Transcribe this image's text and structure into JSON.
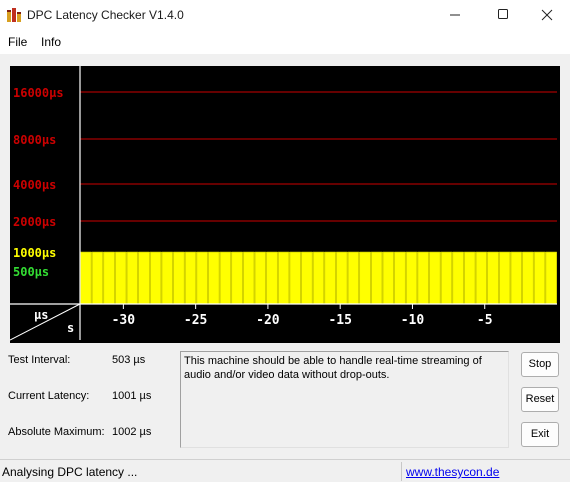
{
  "window": {
    "title": "DPC Latency Checker V1.4.0",
    "icon": "bar-chart-app-icon"
  },
  "menu": {
    "items": [
      "File",
      "Info"
    ]
  },
  "chart_data": {
    "type": "bar",
    "title": "",
    "xlabel": "s",
    "ylabel": "µs",
    "xlim": [
      -33,
      0
    ],
    "x_ticks": [
      -30,
      -25,
      -20,
      -15,
      -10,
      -5
    ],
    "y_scale": "log2",
    "y_ticks": [
      {
        "label": "16000µs",
        "value": 16000,
        "color": "#cc0000"
      },
      {
        "label": "8000µs",
        "value": 8000,
        "color": "#cc0000"
      },
      {
        "label": "4000µs",
        "value": 4000,
        "color": "#cc0000"
      },
      {
        "label": "2000µs",
        "value": 2000,
        "color": "#cc0000"
      },
      {
        "label": "1000µs",
        "value": 1000,
        "color": "#ffff00"
      },
      {
        "label": "500µs",
        "value": 500,
        "color": "#33dd33"
      }
    ],
    "bar_count": 41,
    "bar_value": 1000,
    "bar_color": "#ffff00",
    "background": "#000000",
    "grid": true
  },
  "stats": {
    "interval_label": "Test Interval:",
    "interval_value": "503 µs",
    "current_label": "Current Latency:",
    "current_value": "1001 µs",
    "max_label": "Absolute Maximum:",
    "max_value": "1002 µs"
  },
  "message": "This machine should be able to handle real-time streaming of audio and/or video data without drop-outs.",
  "buttons": {
    "stop": "Stop",
    "reset": "Reset",
    "exit": "Exit"
  },
  "status": {
    "text": "Analysing DPC latency ...",
    "link": "www.thesycon.de"
  }
}
